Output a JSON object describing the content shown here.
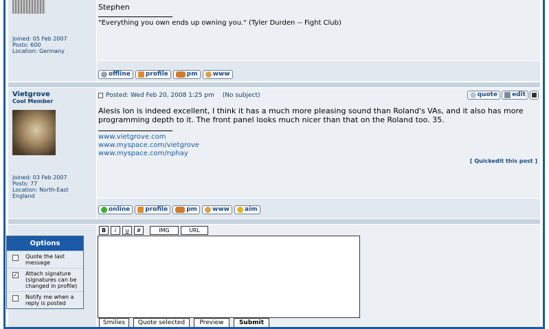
{
  "post1": {
    "message": "Stephen",
    "signature": "\"Everything you own ends up owning you.\" (Tyler Durden -- Fight Club)",
    "joined": "Joined: 05 Feb 2007",
    "posts": "Posts: 600",
    "location": "Location: Germany",
    "buttons": [
      "offline",
      "profile",
      "pm",
      "www"
    ]
  },
  "post2": {
    "username": "Vietgrove",
    "rank": "Cool Member",
    "posted": "Posted: Wed Feb 20, 2008 1:25 pm",
    "subject": "(No subject)",
    "quote_label": "quote",
    "edit_label": "edit",
    "message": "Alesis Ion is indeed excellent, I think it has a much more pleasing sound than Roland's VAs, and it also has more programming depth to it. The front panel looks much nicer than that on the Roland too. 35.",
    "sig_links": [
      "www.vietgrove.com",
      "www.myspace.com/vietgrove",
      "www.myspace.com/nphay"
    ],
    "quickedit": "[ Quickedit this post ]",
    "joined": "Joined: 03 Feb 2007",
    "posts": "Posts: 77",
    "location": "Location: North-East England",
    "buttons": [
      "online",
      "profile",
      "pm",
      "www",
      "aim"
    ]
  },
  "reply": {
    "options_title": "Options",
    "options": [
      {
        "label": "Quote the last message",
        "checked": false
      },
      {
        "label": "Attach signature (signatures can be changed in profile)",
        "checked": true
      },
      {
        "label": "Notify me when a reply is posted",
        "checked": false
      }
    ],
    "format_buttons": [
      "B",
      "i",
      "u",
      "#",
      "IMG",
      "URL"
    ],
    "textarea_value": "",
    "footer_buttons": [
      "Smilies",
      "Quote selected",
      "Preview",
      "Submit"
    ]
  },
  "colors": {
    "border": "#1c5a9c",
    "left_cell": "#e1e8f0",
    "right_cell": "#ecf0f5",
    "options_header": "#1c5aa8"
  }
}
